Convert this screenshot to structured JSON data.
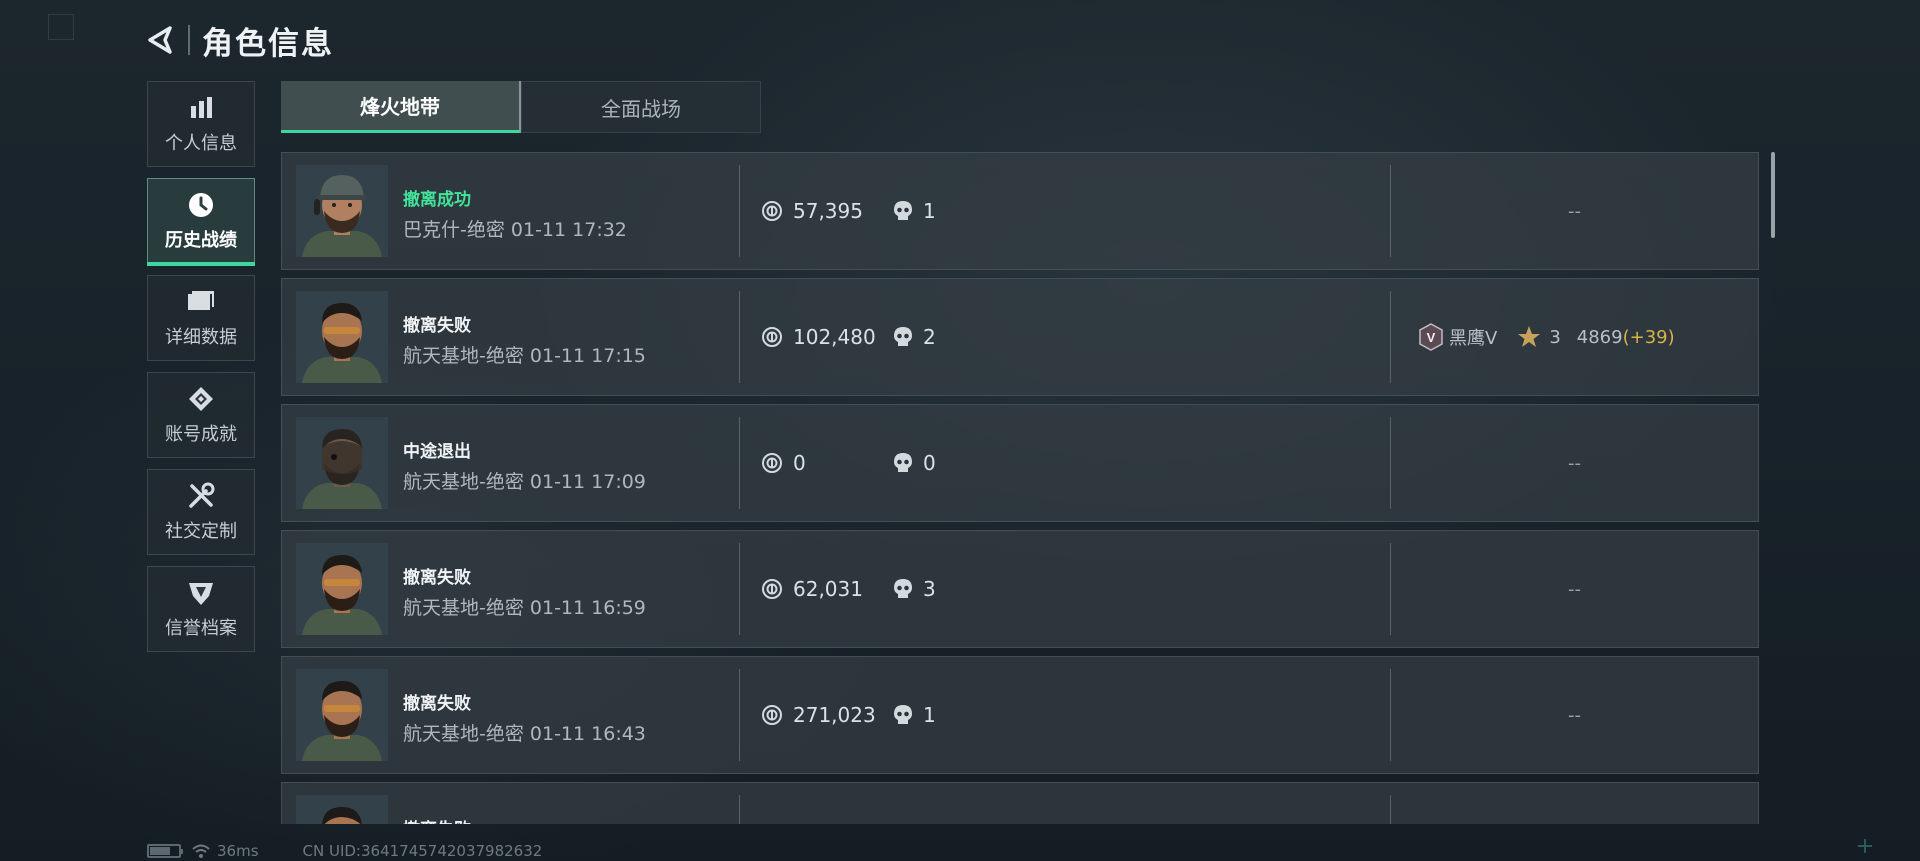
{
  "header": {
    "title": "角色信息"
  },
  "sidebar": {
    "items": [
      {
        "label": "个人信息",
        "icon": "bar-chart-icon",
        "active": false
      },
      {
        "label": "历史战绩",
        "icon": "clock-icon",
        "active": true
      },
      {
        "label": "详细数据",
        "icon": "cards-icon",
        "active": false
      },
      {
        "label": "账号成就",
        "icon": "medal-icon",
        "active": false
      },
      {
        "label": "社交定制",
        "icon": "tools-icon",
        "active": false
      },
      {
        "label": "信誉档案",
        "icon": "shield-icon",
        "active": false
      }
    ]
  },
  "tabs": [
    {
      "label": "烽火地带",
      "active": true
    },
    {
      "label": "全面战场",
      "active": false
    }
  ],
  "matches": [
    {
      "status": "撤离成功",
      "status_type": "success",
      "map": "巴克什-绝密 01-11 17:32",
      "money": "57,395",
      "kills": "1",
      "rank": null
    },
    {
      "status": "撤离失败",
      "status_type": "fail",
      "map": "航天基地-绝密 01-11 17:15",
      "money": "102,480",
      "kills": "2",
      "rank": {
        "tier": "黑鹰V",
        "stars": "3",
        "points": "4869",
        "delta": "(+39)"
      }
    },
    {
      "status": "中途退出",
      "status_type": "quit",
      "map": "航天基地-绝密 01-11 17:09",
      "money": "0",
      "kills": "0",
      "rank": null
    },
    {
      "status": "撤离失败",
      "status_type": "fail",
      "map": "航天基地-绝密 01-11 16:59",
      "money": "62,031",
      "kills": "3",
      "rank": null
    },
    {
      "status": "撤离失败",
      "status_type": "fail",
      "map": "航天基地-绝密 01-11 16:43",
      "money": "271,023",
      "kills": "1",
      "rank": null
    },
    {
      "status": "撤离失败",
      "status_type": "fail",
      "map": "",
      "money": "",
      "kills": "",
      "rank": null
    }
  ],
  "empty_placeholder": "--",
  "footer": {
    "ping": "36ms",
    "uid": "CN UID:3641745742037982632",
    "battery_level": 0.7
  },
  "colors": {
    "accent": "#3fd6a0",
    "success_text": "#43e39b",
    "rank_delta": "#d9b248"
  }
}
